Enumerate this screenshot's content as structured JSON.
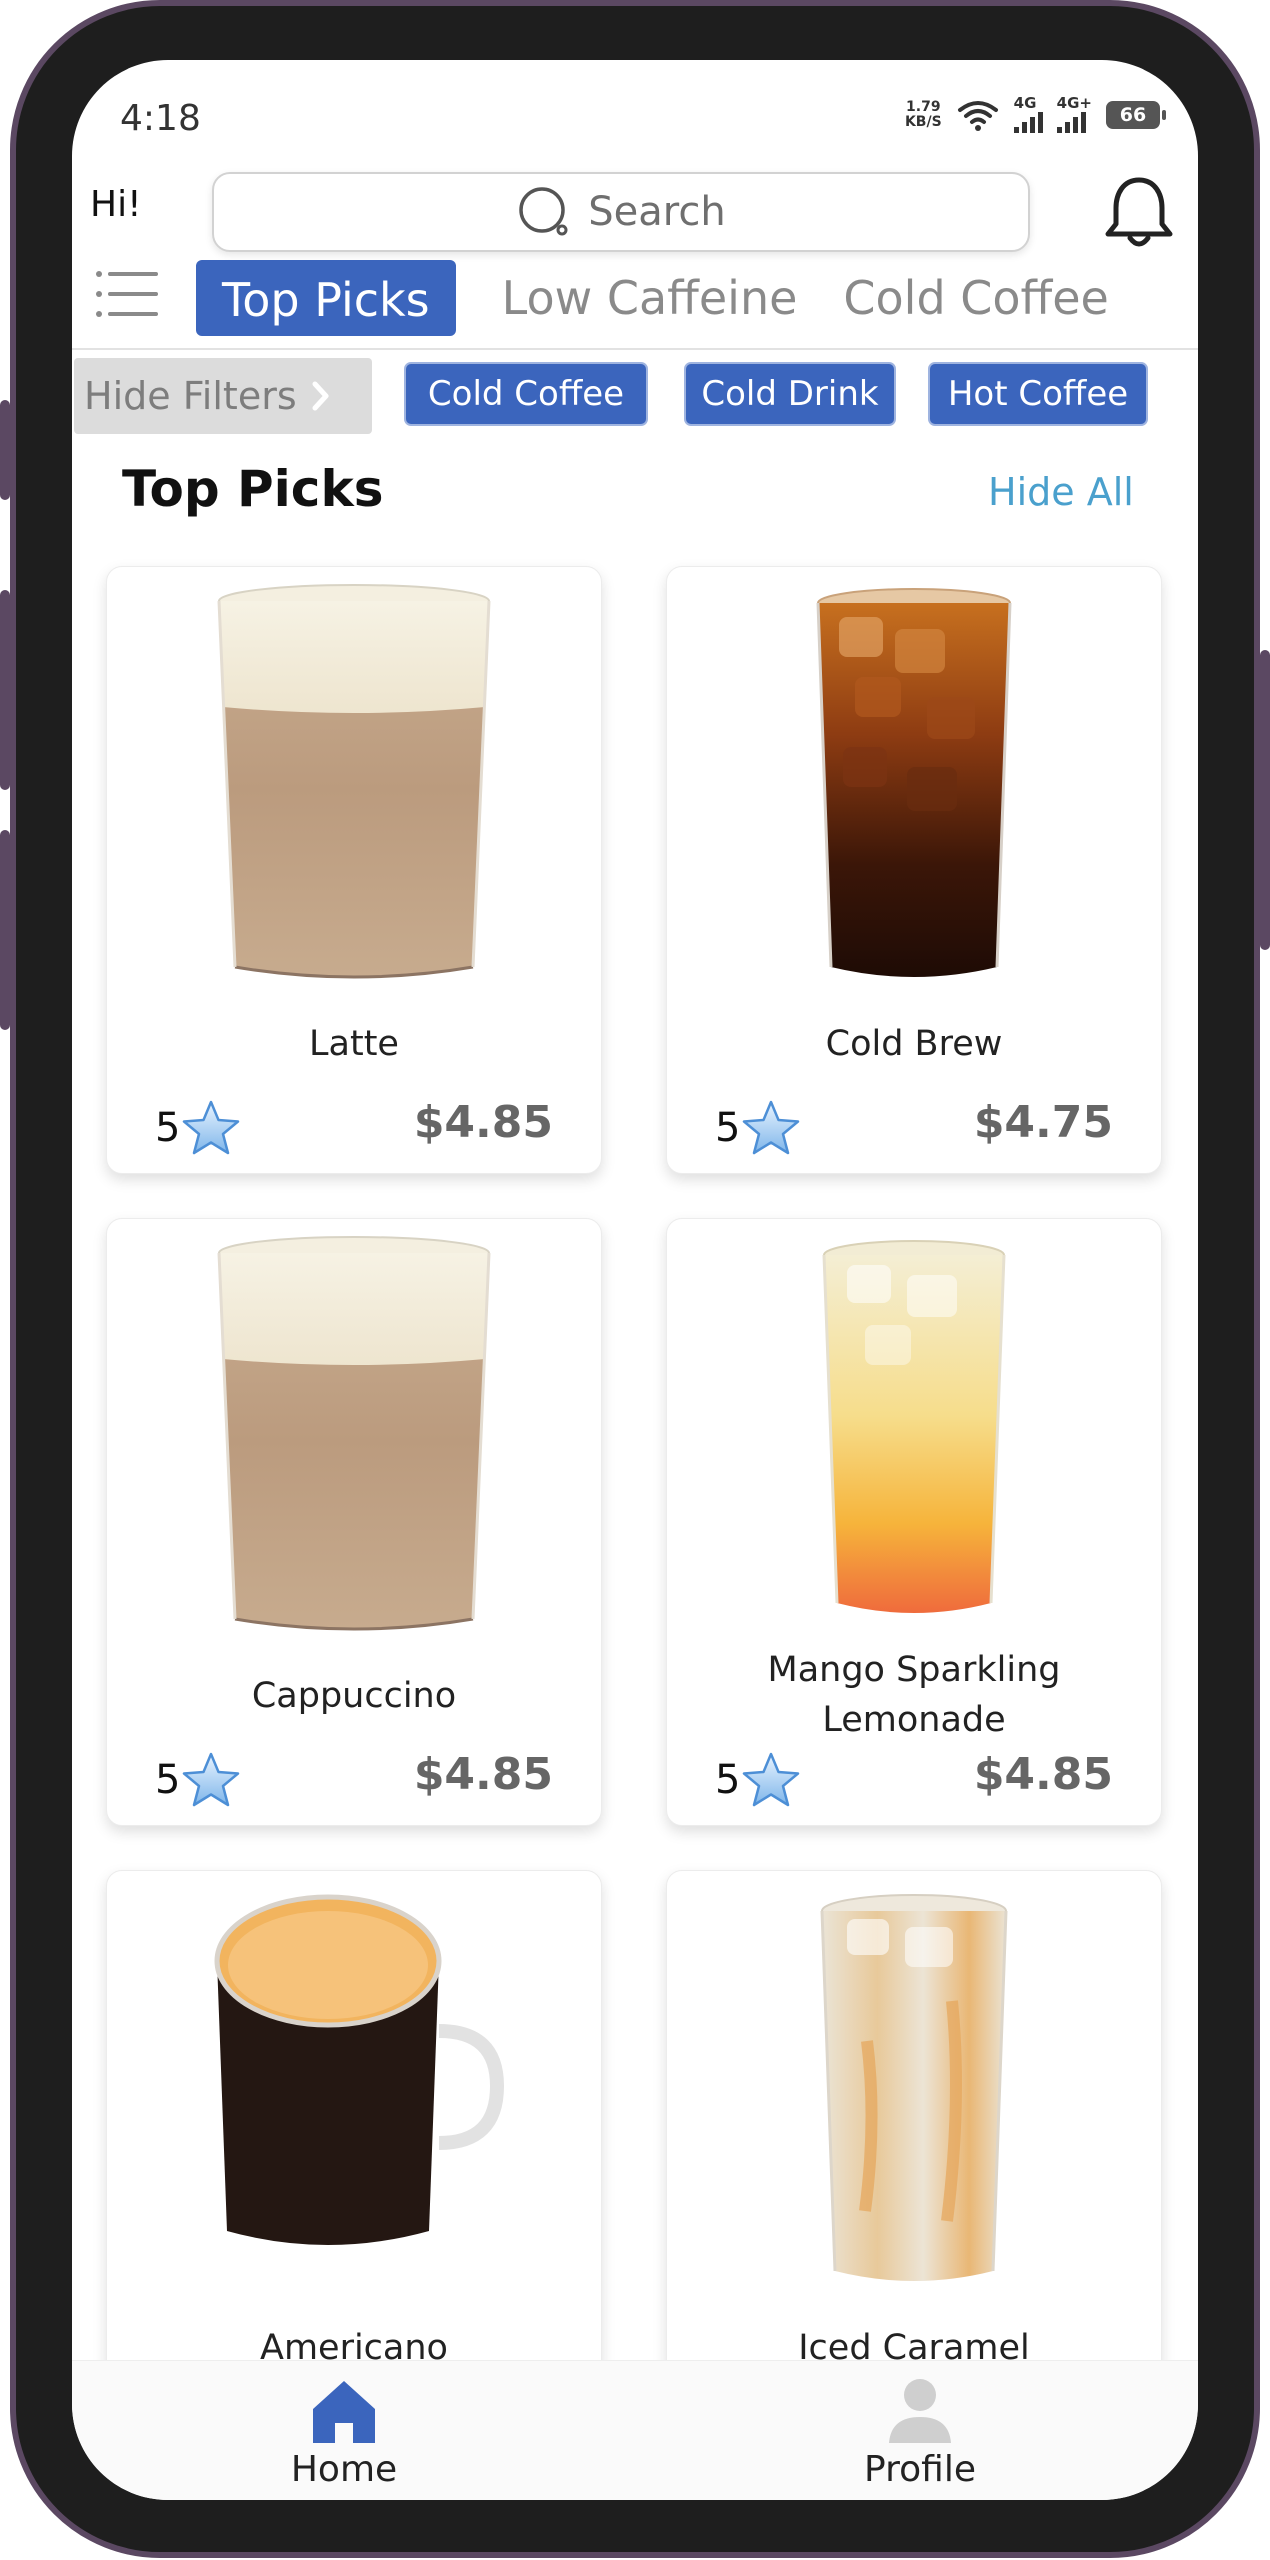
{
  "status_bar": {
    "time": "4:18",
    "net_speed_value": "1.79",
    "net_speed_unit": "KB/S",
    "signal1_label": "4G",
    "signal2_label": "4G+",
    "battery": "66"
  },
  "header": {
    "greeting": "Hi!",
    "search_placeholder": "Search"
  },
  "tabs": [
    {
      "label": "Top Picks",
      "active": true
    },
    {
      "label": "Low Caffeine",
      "active": false
    },
    {
      "label": "Cold Coffee",
      "active": false
    }
  ],
  "filters": {
    "hide_label": "Hide Filters",
    "chips": [
      "Cold Coffee",
      "Cold Drink",
      "Hot Coffee"
    ]
  },
  "section": {
    "title": "Top Picks",
    "hide_all": "Hide All"
  },
  "products": [
    {
      "name": "Latte",
      "rating": "5",
      "price": "$4.85",
      "image": "latte-glass"
    },
    {
      "name": "Cold Brew",
      "rating": "5",
      "price": "$4.75",
      "image": "iced-coffee-glass"
    },
    {
      "name": "Cappuccino",
      "rating": "5",
      "price": "$4.85",
      "image": "cappuccino-glass"
    },
    {
      "name": "Mango Sparkling Lemonade",
      "rating": "5",
      "price": "$4.85",
      "image": "lemonade-glass"
    },
    {
      "name": "Americano",
      "image": "coffee-mug"
    },
    {
      "name": "Iced Caramel",
      "image": "iced-caramel-glass"
    }
  ],
  "bottom_nav": {
    "home": "Home",
    "profile": "Profile"
  },
  "colors": {
    "accent": "#3b65bd",
    "link": "#4aa0cd",
    "frame": "#5b4862"
  }
}
